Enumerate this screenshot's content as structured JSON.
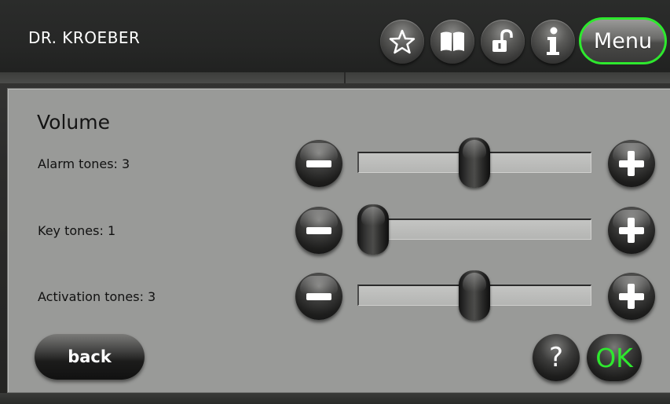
{
  "header": {
    "title": "DR. KROEBER",
    "icons": [
      "star-icon",
      "book-icon",
      "unlock-icon",
      "info-icon"
    ],
    "menu_label": "Menu",
    "menu_border_color": "#2ee82e"
  },
  "panel": {
    "heading": "Volume",
    "rows": [
      {
        "label": "Alarm tones: 3",
        "level": 3,
        "slider_fraction": 0.5
      },
      {
        "label": "Key tones: 1",
        "level": 1,
        "slider_fraction": 0.0
      },
      {
        "label": "Activation tones: 3",
        "level": 3,
        "slider_fraction": 0.5
      }
    ],
    "decrease_icon": "minus-icon",
    "increase_icon": "plus-icon"
  },
  "footer": {
    "back_label": "back",
    "help_label": "?",
    "ok_label": "OK",
    "ok_color": "#2ee82e"
  }
}
